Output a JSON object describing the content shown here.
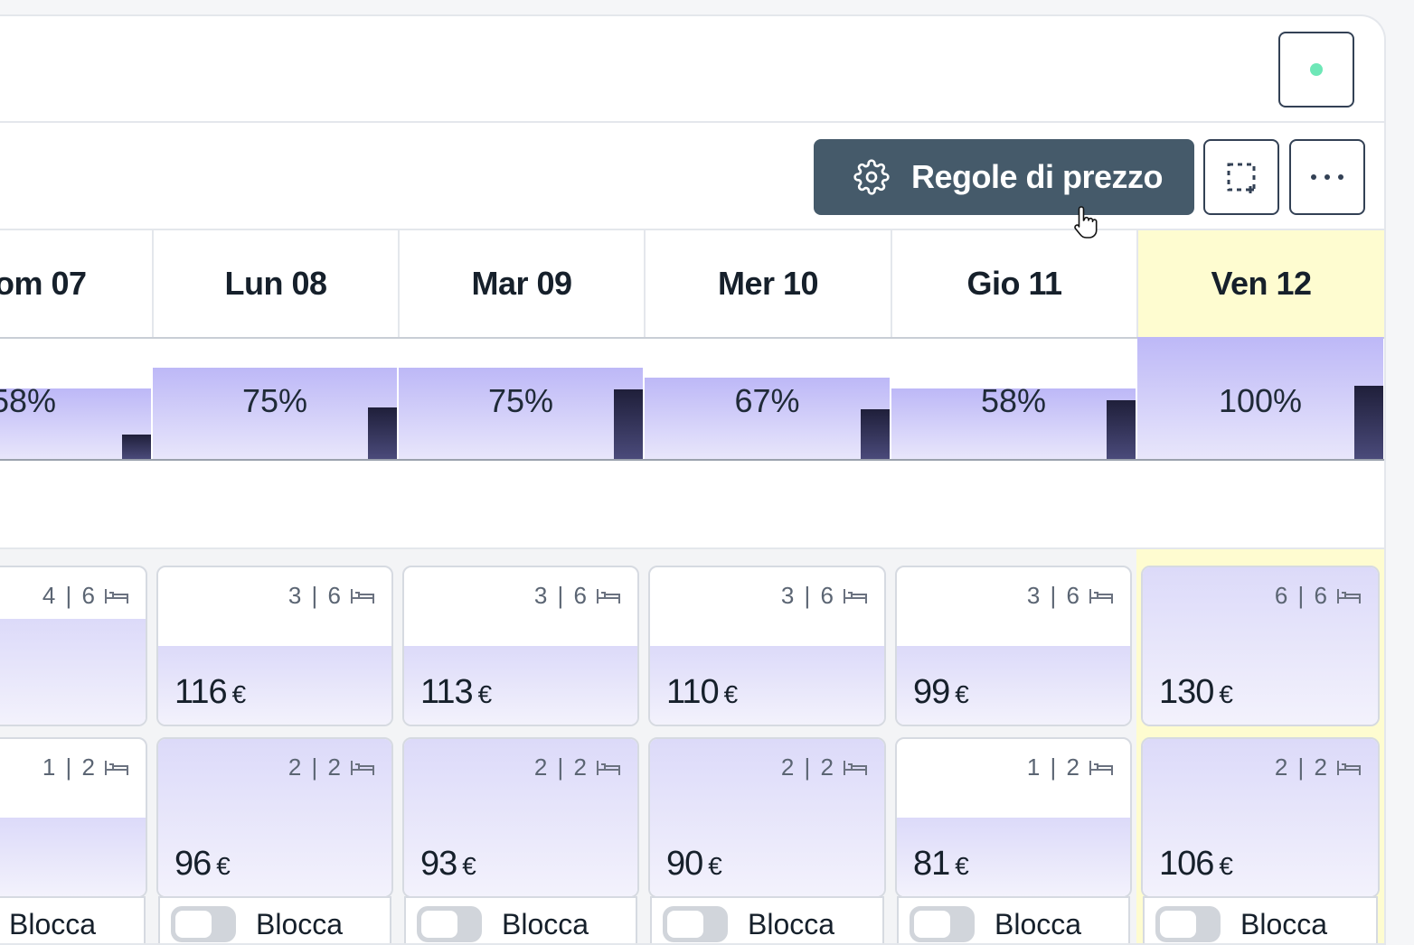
{
  "colors": {
    "accent": "#455a6a",
    "status_dot": "#6ee7b7",
    "today_bg": "#fefcd0"
  },
  "toolbar": {
    "rules_label": "Regole di prezzo",
    "rules_icon": "gear-icon",
    "select_icon": "select-area-icon",
    "more_icon": "more-dots-icon"
  },
  "days": [
    {
      "label": "om 07"
    },
    {
      "label": "Lun 08"
    },
    {
      "label": "Mar 09"
    },
    {
      "label": "Mer 10"
    },
    {
      "label": "Gio 11"
    },
    {
      "label": "Ven 12",
      "today": true
    }
  ],
  "occupancy": [
    {
      "label": "58%",
      "value": 58,
      "mini": 0.2
    },
    {
      "label": "75%",
      "value": 75,
      "mini": 0.42
    },
    {
      "label": "75%",
      "value": 75,
      "mini": 0.57
    },
    {
      "label": "67%",
      "value": 67,
      "mini": 0.41
    },
    {
      "label": "58%",
      "value": 58,
      "mini": 0.48
    },
    {
      "label": "100%",
      "value": 100,
      "mini": 0.6
    }
  ],
  "room_rows": [
    {
      "cells": [
        {
          "units": "4 | 6",
          "price": "",
          "currency": "€",
          "fill": 0.67
        },
        {
          "units": "3 | 6",
          "price": "116",
          "currency": "€",
          "fill": 0.5
        },
        {
          "units": "3 | 6",
          "price": "113",
          "currency": "€",
          "fill": 0.5
        },
        {
          "units": "3 | 6",
          "price": "110",
          "currency": "€",
          "fill": 0.5
        },
        {
          "units": "3 | 6",
          "price": "99",
          "currency": "€",
          "fill": 0.5
        },
        {
          "units": "6 | 6",
          "price": "130",
          "currency": "€",
          "fill": 1.0
        }
      ]
    },
    {
      "cells": [
        {
          "units": "1 | 2",
          "price": "",
          "currency": "",
          "fill": 0.5
        },
        {
          "units": "2 | 2",
          "price": "96",
          "currency": "€",
          "fill": 1.0
        },
        {
          "units": "2 | 2",
          "price": "93",
          "currency": "€",
          "fill": 1.0
        },
        {
          "units": "2 | 2",
          "price": "90",
          "currency": "€",
          "fill": 1.0
        },
        {
          "units": "1 | 2",
          "price": "81",
          "currency": "€",
          "fill": 0.5
        },
        {
          "units": "2 | 2",
          "price": "106",
          "currency": "€",
          "fill": 1.0
        }
      ]
    }
  ],
  "block": {
    "label": "Blocca"
  }
}
